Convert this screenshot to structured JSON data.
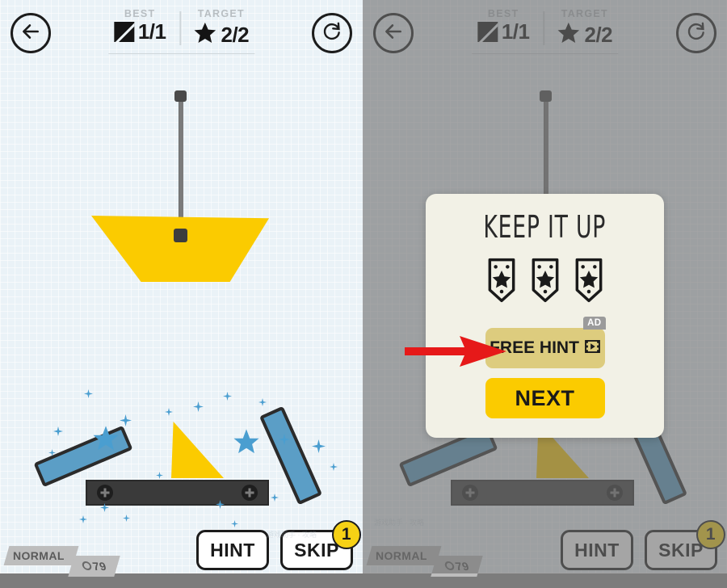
{
  "header": {
    "back_icon": "arrow-left-icon",
    "restart_icon": "restart-icon",
    "best_label": "BEST",
    "best_value": "1/1",
    "best_icon": "square-slash-icon",
    "target_label": "TARGET",
    "target_value": "2/2",
    "target_icon": "star-icon"
  },
  "bottom": {
    "difficulty_tag": "NORMAL",
    "coins_tag": "79",
    "coin_icon": "coin-icon",
    "hint_label": "HINT",
    "skip_label": "SKIP",
    "skip_badge": "1"
  },
  "modal": {
    "title": "KEEP IT UP",
    "badge_icon": "star-banner-icon",
    "badge_count": 3,
    "free_hint_label": "FREE HINT",
    "free_hint_video_icon": "video-play-icon",
    "ad_tag": "AD",
    "next_label": "NEXT"
  },
  "annotation": {
    "arrow_icon": "red-arrow-right-icon",
    "arrow_color": "#e61919"
  },
  "colors": {
    "background": "#eaf2f7",
    "yellow": "#fbcb00",
    "blue_plank": "#5b9ec6",
    "dark": "#1c1c1c",
    "platform": "#3a3a3a",
    "modal_bg": "#f2f1e6",
    "free_hint_bg": "#ddcc7e",
    "tag_grey": "#bdbdbd",
    "dim_overlay": "rgba(110,110,110,.62)"
  },
  "watermark": {
    "text": "游戏助手 · 攻略"
  }
}
